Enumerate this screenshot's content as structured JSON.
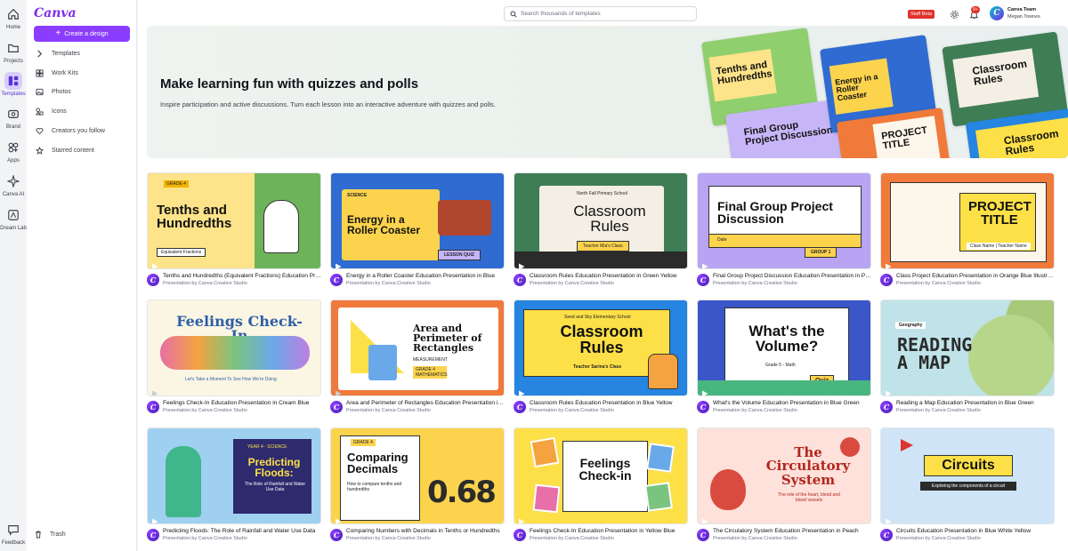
{
  "app": {
    "logo": "Canva"
  },
  "rail": [
    {
      "label": "Home",
      "icon": "home-icon"
    },
    {
      "label": "Projects",
      "icon": "folder-icon"
    },
    {
      "label": "Templates",
      "icon": "templates-icon",
      "active": true
    },
    {
      "label": "Brand",
      "icon": "brand-icon"
    },
    {
      "label": "Apps",
      "icon": "apps-icon"
    },
    {
      "label": "Canva AI",
      "icon": "sparkle-icon"
    },
    {
      "label": "Dream Lab",
      "icon": "dream-lab-icon"
    },
    {
      "label": "Feedback",
      "icon": "feedback-icon"
    }
  ],
  "panel": {
    "create_label": "Create a design",
    "items": [
      {
        "label": "Templates",
        "icon": "chevron-right-icon"
      },
      {
        "label": "Work Kits",
        "icon": "work-kits-icon"
      },
      {
        "label": "Photos",
        "icon": "photo-icon"
      },
      {
        "label": "Icons",
        "icon": "shapes-icon"
      },
      {
        "label": "Creators you follow",
        "icon": "heart-icon"
      },
      {
        "label": "Starred content",
        "icon": "star-icon"
      }
    ],
    "trash_label": "Trash"
  },
  "header": {
    "search_placeholder": "Search thousands of templates",
    "staff_badge": "Staff Beta",
    "notifications_count": "9+",
    "account_name": "Canva Team",
    "account_user": "Megan Townes"
  },
  "banner": {
    "title": "Make learning fun with quizzes and polls",
    "subtitle": "Inspire participation and active discussions. Turn each lesson into an interactive adventure with quizzes and polls.",
    "collage": [
      "Tenths and Hundredths",
      "Energy in a Roller Coaster",
      "Classroom Rules",
      "Final Group Project Discussion",
      "PROJECT TITLE",
      "Classroom Rules"
    ]
  },
  "templates": [
    {
      "title": "Tenths and Hundredths (Equivalent Fractions) Education Presentation in Green",
      "by": "Presentation by Canva Creative Studio",
      "thumb_text": "Tenths and Hundredths",
      "thumb_sub": "Equivalent Fractions",
      "tag": "GRADE 4",
      "bg": "#6db35a",
      "panel": "#fde38a"
    },
    {
      "title": "Energy in a Roller Coaster Education Presentation in Blue",
      "by": "Presentation by Canva Creative Studio",
      "thumb_text": "Energy in a Roller Coaster",
      "thumb_sub": "LESSON QUIZ",
      "tag": "SCIENCE",
      "bg": "#2f6bd1",
      "panel": "#fcd34d"
    },
    {
      "title": "Classroom Rules Education Presentation in Green Yellow",
      "by": "Presentation by Canva Creative Studio",
      "thumb_text": "Classroom Rules",
      "thumb_sub": "Teacher Mia's Class",
      "tag": "North Fall Primary School",
      "bg": "#3f7d55",
      "panel": "#f4efe4"
    },
    {
      "title": "Final Group Project Discussion Education Presentation in Purple",
      "by": "Presentation by Canva Creative Studio",
      "thumb_text": "Final Group Project Discussion",
      "thumb_sub": "GROUP 1",
      "tag": "Date",
      "bg": "#b8a4f3",
      "panel": "#ffffff"
    },
    {
      "title": "Class Project Education Presentation in Orange Blue Illustrative",
      "by": "Presentation by Canva Creative Studio",
      "thumb_text": "PROJECT TITLE",
      "thumb_sub": "Class Name | Teacher Name",
      "tag": "",
      "bg": "#f07a3a",
      "panel": "#fdf6ea"
    },
    {
      "title": "Feelings Check-In Education Presentation in Cream Blue",
      "by": "Presentation by Canva Creative Studio",
      "thumb_text": "Feelings Check-In",
      "thumb_sub": "Let's Take a Moment To See How We're Doing",
      "tag": "",
      "bg": "#fbf6e3",
      "panel": "#fbf6e3"
    },
    {
      "title": "Area and Perimeter of Rectangles Education Presentation in Orange",
      "by": "Presentation by Canva Creative Studio",
      "thumb_text": "Area and Perimeter of Rectangles",
      "thumb_sub": "MEASUREMENT",
      "tag": "GRADE 4 MATHEMATICS",
      "bg": "#f0793c",
      "panel": "#ffffff"
    },
    {
      "title": "Classroom Rules Education Presentation in Blue Yellow",
      "by": "Presentation by Canva Creative Studio",
      "thumb_text": "Classroom Rules",
      "thumb_sub": "Teacher Sarina's Class",
      "tag": "Seed and Sky Elementary School",
      "bg": "#2585e0",
      "panel": "#fde047"
    },
    {
      "title": "What's the Volume Education Presentation in Blue Green",
      "by": "Presentation by Canva Creative Studio",
      "thumb_text": "What's the Volume?",
      "thumb_sub": "Grade 5 - Math",
      "tag": "Quiz",
      "bg": "#3a56c9",
      "panel": "#ffffff"
    },
    {
      "title": "Reading a Map Education Presentation in Blue Green",
      "by": "Presentation by Canva Creative Studio",
      "thumb_text": "READING A MAP",
      "thumb_sub": "Geography",
      "tag": "",
      "bg": "#bfe3e8",
      "panel": "#bfe3e8"
    },
    {
      "title": "Predicting Floods: The Role of Rainfall and Water Use Data",
      "by": "Presentation by Canva Creative Studio",
      "thumb_text": "Predicting Floods:",
      "thumb_sub": "The Role of Rainfall and Water Use Data",
      "tag": "YEAR 4 - SCIENCE",
      "bg": "#9fd0ef",
      "panel": "#2d2a6e"
    },
    {
      "title": "Comparing Numbers with Decimals in Tenths or Hundredths",
      "by": "Presentation by Canva Creative Studio",
      "thumb_text": "Comparing Decimals",
      "thumb_sub": "How to compare tenths and hundredths",
      "tag": "GRADE 4",
      "bg": "#fcd34d",
      "panel": "#fcd34d"
    },
    {
      "title": "Feelings Check-In Education Presentation in Yellow Blue",
      "by": "Presentation by Canva Creative Studio",
      "thumb_text": "Feelings Check-in",
      "thumb_sub": "",
      "tag": "",
      "bg": "#fde047",
      "panel": "#ffffff"
    },
    {
      "title": "The Circulatory System Education Presentation in Peach",
      "by": "Presentation by Canva Creative Studio",
      "thumb_text": "The Circulatory System",
      "thumb_sub": "The role of the heart, blood and blood vessels",
      "tag": "",
      "bg": "#fde1da",
      "panel": "#fde1da"
    },
    {
      "title": "Circuits Education Presentation in Blue White Yellow",
      "by": "Presentation by Canva Creative Studio",
      "thumb_text": "Circuits",
      "thumb_sub": "Exploring the components of a circuit",
      "tag": "",
      "bg": "#cfe4f7",
      "panel": "#fde047"
    }
  ]
}
